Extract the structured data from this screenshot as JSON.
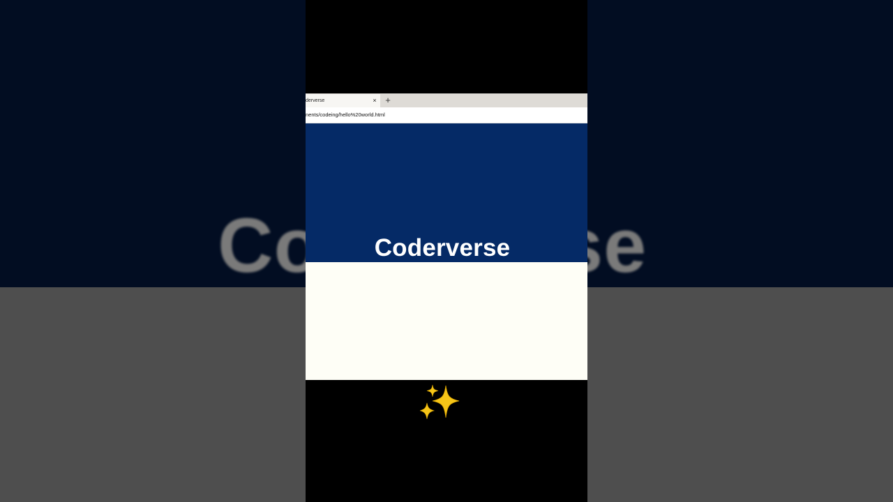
{
  "background": {
    "blurred_title": "Coderverse"
  },
  "browser": {
    "tab_title": "derverse",
    "tab_close_glyph": "×",
    "new_tab_glyph": "+",
    "url": "nents/codeing/hello%20world.html"
  },
  "page": {
    "hero_title": "Coderverse",
    "hero_color": "#052a66",
    "body_color": "#fefef6"
  },
  "overlay": {
    "icon": "sparkles-icon"
  }
}
